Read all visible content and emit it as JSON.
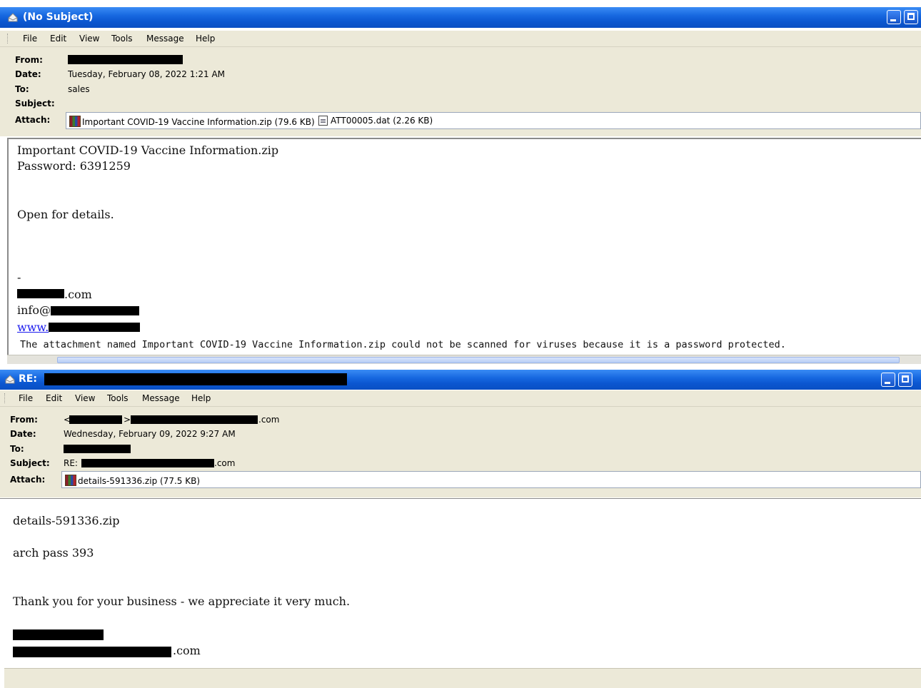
{
  "window1": {
    "title": "(No Subject)",
    "menu": [
      "File",
      "Edit",
      "View",
      "Tools",
      "Message",
      "Help"
    ],
    "headers": {
      "from_label": "From:",
      "date_label": "Date:",
      "date": "Tuesday, February 08, 2022 1:21 AM",
      "to_label": "To:",
      "to": "sales",
      "subject_label": "Subject:",
      "attach_label": "Attach:"
    },
    "attachments": [
      {
        "name": "Important COVID-19 Vaccine Information.zip (79.6 KB)",
        "icon": "zip-icon"
      },
      {
        "name": "ATT00005.dat (2.26 KB)",
        "icon": "dat-file-icon"
      }
    ],
    "body": {
      "line1": "Important COVID-19 Vaccine Information.zip",
      "line2": "Password: 6391259",
      "line3": "Open for details.",
      "sig_dash": "-",
      "sig_domain_suffix": ".com",
      "sig_email_prefix": "info@",
      "sig_www": "www.",
      "scan_notice": "The attachment named Important COVID-19 Vaccine Information.zip could not be scanned for viruses because it is a password protected."
    }
  },
  "window2": {
    "title": "RE:",
    "menu": [
      "File",
      "Edit",
      "View",
      "Tools",
      "Message",
      "Help"
    ],
    "headers": {
      "from_label": "From:",
      "from_lt": "<",
      "from_gt": ">",
      "from_suffix": ".com",
      "date_label": "Date:",
      "date": "Wednesday, February 09, 2022 9:27 AM",
      "to_label": "To:",
      "subject_label": "Subject:",
      "subject_prefix": "RE:",
      "subject_suffix": ".com",
      "attach_label": "Attach:"
    },
    "attachments": [
      {
        "name": "details-591336.zip (77.5 KB)",
        "icon": "zip-icon"
      }
    ],
    "body": {
      "line1": "details-591336.zip",
      "line2": "arch pass 393",
      "line3": "Thank you for your business - we appreciate it very much.",
      "sig_suffix": ".com"
    }
  },
  "colors": {
    "titlebar_blue": "#0b56d0",
    "chrome_beige": "#ece9d8",
    "redaction": "#000000",
    "link": "#1a1aee"
  }
}
